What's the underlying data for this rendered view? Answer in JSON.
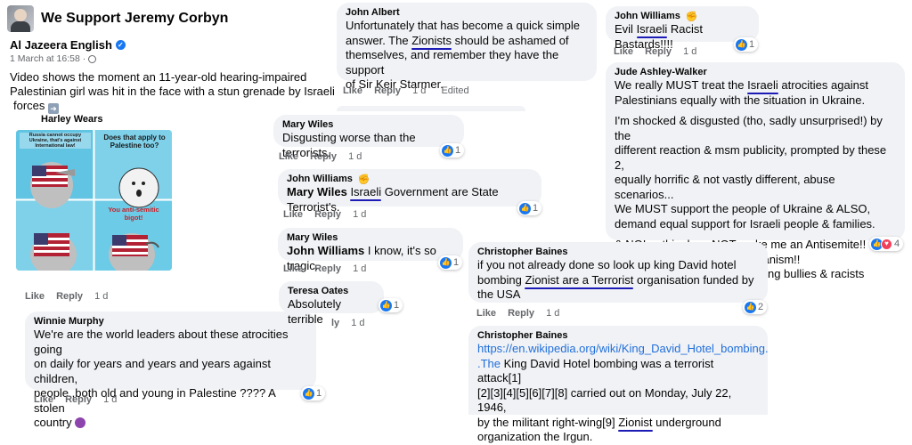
{
  "group": {
    "name": "We Support Jeremy Corbyn"
  },
  "post": {
    "author": "Al Jazeera English",
    "date": "1 March at 16:58",
    "dot": "·",
    "text_line1": "Video shows the moment an 11-year-old hearing-impaired",
    "text_line2": "Palestinian girl was hit in the face with a stun grenade by Israeli",
    "text_line3": "forces"
  },
  "harley": {
    "author": "Harley Wears",
    "meme": {
      "tl": "Russia cannot occupy Ukraine, that's against International law!",
      "tr": "Does that apply to Palestine too?",
      "br": "You anti-semitic bigot!"
    },
    "actions": {
      "like": "Like",
      "reply": "Reply",
      "time": "1 d"
    }
  },
  "winnie": {
    "author": "Winnie Murphy",
    "lines": [
      "We're are the world leaders about these atrocities going",
      "on daily for years and years and years against children,",
      "people ,both old and young in Palestine ???? A stolen",
      "country"
    ],
    "reactions": "1",
    "actions": {
      "like": "Like",
      "reply": "Reply",
      "time": "1 d"
    }
  },
  "john_albert": {
    "author": "John Albert",
    "line1": "Unfortunately that has become a quick simple",
    "line2_pre": "answer. The ",
    "line2_hl": "Zionists",
    "line2_post": " should be ashamed of",
    "line3": "themselves, and remember they have the support",
    "line4": "of Sir Keir Starmer.",
    "actions": {
      "like": "Like",
      "reply": "Reply",
      "time": "1 d",
      "edited": "Edited"
    }
  },
  "mary1": {
    "author": "Mary Wiles",
    "text": "Disgusting worse than the terrorists.",
    "reactions": "1",
    "actions": {
      "like": "Like",
      "reply": "Reply",
      "time": "1 d"
    }
  },
  "jw2": {
    "author": "John Williams",
    "mention": "Mary Wiles",
    "hl": "Israeli",
    "post": " Government are State Terrorist's.",
    "reactions": "1",
    "actions": {
      "like": "Like",
      "reply": "Reply",
      "time": "1 d"
    }
  },
  "mary2": {
    "author": "Mary Wiles",
    "mention": "John Williams",
    "text": " I know, it's so tragic.",
    "reactions": "1",
    "actions": {
      "like": "Like",
      "reply": "Reply",
      "time": "1 d"
    }
  },
  "teresa": {
    "author": "Teresa Oates",
    "text": "Absolutely terrible",
    "reactions": "1",
    "actions": {
      "reply_tail": "ly",
      "time": "1 d"
    }
  },
  "jw1": {
    "author": "John Williams",
    "pre": "Evil ",
    "hl": "Israeli",
    "post": " Racist Bastards!!!!",
    "reactions": "1",
    "actions": {
      "like": "Like",
      "reply": "Reply",
      "time": "1 d"
    }
  },
  "jude": {
    "author": "Jude Ashley-Walker",
    "p1_line1_pre": "We really MUST treat the ",
    "p1_line1_hl": "Israeli",
    "p1_line1_post": " atrocities against",
    "p1_line2": "Palestinians equally with the situation in Ukraine.",
    "p2": [
      "I'm shocked & disgusted (tho, sadly unsurprised!) by the",
      "different reaction & msm publicity, prompted by these 2,",
      "equally horrific & not vastly different, abuse scenarios...",
      "We MUST support the people of Ukraine & ALSO,",
      "demand equal support for Israeli people & families."
    ],
    "p3": [
      "& NO! ... this does NOT make me an Antisemite!!",
      "It means I'm PRO humanitarianism!!",
      "& I believe in justice & in fighting bullies & racists"
    ],
    "reactions": "4"
  },
  "cb1": {
    "author": "Christopher Baines",
    "line1": "if you not already done so look up king David hotel",
    "line2_pre": "bombing ",
    "line2_hl": "Zionist are a Terrorist",
    "line2_post": " organisation funded by",
    "line3": "the USA",
    "reactions": "2",
    "actions": {
      "like": "Like",
      "reply": "Reply",
      "time": "1 d"
    }
  },
  "cb2": {
    "author": "Christopher Baines",
    "link1": "https://en.wikipedia.org/wiki/King_David_Hotel_bombing.",
    "link2": ".The",
    "line2_post": " King David Hotel bombing was a terrorist attack[1]",
    "line3": "[2][3][4][5][6][7][8] carried out on Monday, July 22, 1946,",
    "line4_pre": "by the militant right-wing[9] ",
    "line4_hl": "Zionist",
    "line4_post": " underground",
    "line5": "organization the Irgun."
  },
  "colors": {
    "underline": "#1c1bb5",
    "link": "#216fdb",
    "bubble": "#f0f2f5",
    "like_blue": "#1877f2"
  }
}
